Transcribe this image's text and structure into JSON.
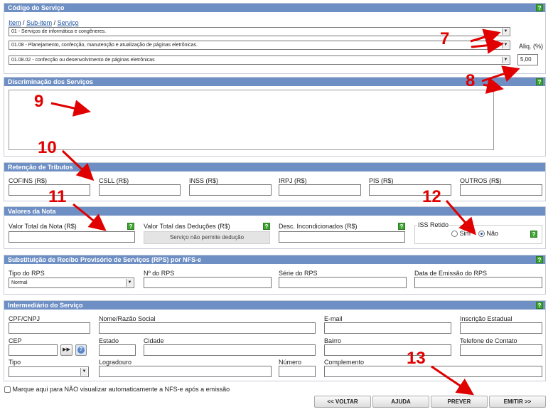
{
  "servico": {
    "title": "Código do Serviço",
    "help": "?",
    "crumb": {
      "item": "Item",
      "sep": "/",
      "subitem": "Sub-item",
      "servico": "Serviço"
    },
    "select1": "01 - Serviços de informática e congêneres.",
    "select2": "01.08 - Planejamento, confecção, manutenção e atualização de páginas eletrônicas.",
    "select3": "01.08.02 - confecção ou desenvolvimento de páginas eletrônicas",
    "aliq_label": "Aliq. (%)",
    "aliq_value": "5,00"
  },
  "discriminacao": {
    "title": "Discriminação dos Serviços",
    "help": "?"
  },
  "retencao": {
    "title": "Retenção de Tributos",
    "fields": [
      "COFINS (R$)",
      "CSLL (R$)",
      "INSS (R$)",
      "IRPJ (R$)",
      "PIS (R$)",
      "OUTROS (R$)"
    ]
  },
  "valores": {
    "title": "Valores da Nota",
    "total": "Valor Total da Nota (R$)",
    "deducoes": "Valor Total das Deduções (R$)",
    "deducoes_msg": "Serviço não permite dedução",
    "desc": "Desc. Incondicionados (R$)",
    "iss_label": "ISS Retido",
    "sim": "Sim",
    "nao": "Não",
    "help": "?"
  },
  "rps": {
    "title": "Substituição de Recibo Provisório de Serviços (RPS) por NFS-e",
    "help": "?",
    "tipo_label": "Tipo do RPS",
    "tipo_value": "Normal",
    "numero": "Nº do RPS",
    "serie": "Série do RPS",
    "data": "Data de Emissão do RPS"
  },
  "intermediario": {
    "title": "Intermediário do Serviço",
    "help": "?",
    "cpf": "CPF/CNPJ",
    "nome": "Nome/Razão Social",
    "email": "E-mail",
    "ie": "Inscrição Estadual",
    "cep": "CEP",
    "estado": "Estado",
    "cidade": "Cidade",
    "bairro": "Bairro",
    "telefone": "Telefone de Contato",
    "tipo": "Tipo",
    "logradouro": "Logradouro",
    "numero": "Número",
    "complemento": "Complemento",
    "go": "▶▶",
    "lookup": "?"
  },
  "footer": {
    "checkbox": "Marque aqui para NÃO visualizar automaticamente a NFS-e após a emissão",
    "voltar": "<< VOLTAR",
    "ajuda": "AJUDA",
    "prever": "PREVER",
    "emitir": "EMITIR >>"
  },
  "callouts": [
    "7",
    "8",
    "9",
    "10",
    "11",
    "12",
    "13"
  ],
  "colors": {
    "header": "#6e8fc4",
    "help": "#3fa531",
    "callout": "#e00000"
  }
}
